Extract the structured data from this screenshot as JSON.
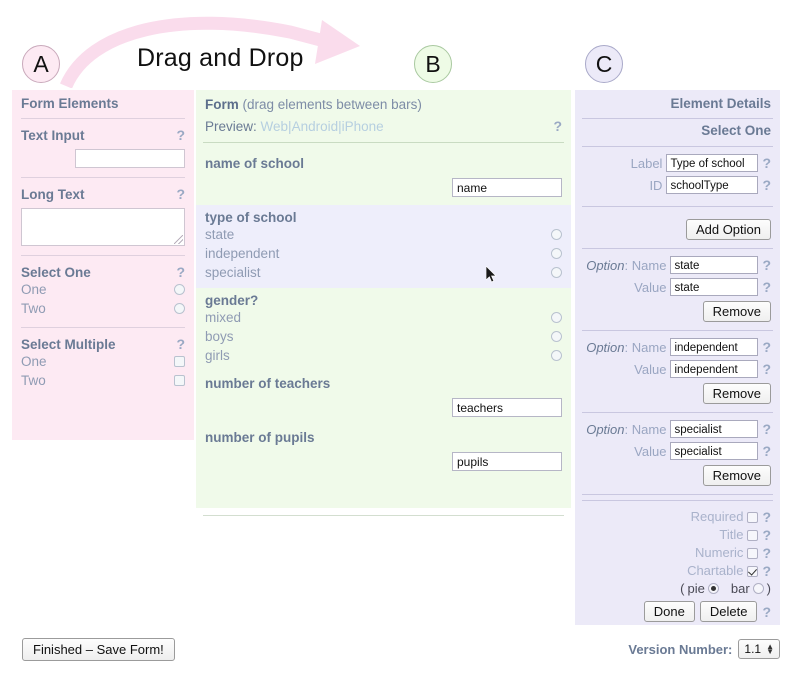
{
  "annotations": {
    "a": "A",
    "b": "B",
    "c": "C",
    "drag_label": "Drag and Drop"
  },
  "panel_a": {
    "title": "Form Elements",
    "help": "?",
    "blocks": [
      {
        "title": "Text Input",
        "help": "?",
        "type": "text"
      },
      {
        "title": "Long Text",
        "help": "?",
        "type": "textarea"
      },
      {
        "title": "Select One",
        "help": "?",
        "type": "radio",
        "options": [
          "One",
          "Two"
        ]
      },
      {
        "title": "Select Multiple",
        "help": "?",
        "type": "checkbox",
        "options": [
          "One",
          "Two"
        ]
      }
    ]
  },
  "panel_b": {
    "title_bold": "Form",
    "title_rest": " (drag elements between bars)",
    "preview_label": "Preview:",
    "preview_links": [
      "Web",
      "Android",
      "iPhone"
    ],
    "preview_separator": "|",
    "help": "?",
    "fields": [
      {
        "label": "name of school",
        "type": "text",
        "value": "name",
        "selected": false
      },
      {
        "label": "type of school",
        "type": "radio",
        "options": [
          "state",
          "independent",
          "specialist"
        ],
        "selected": true
      },
      {
        "label": "gender?",
        "type": "radio",
        "options": [
          "mixed",
          "boys",
          "girls"
        ],
        "selected": false
      },
      {
        "label": "number of teachers",
        "type": "text",
        "value": "teachers",
        "selected": false
      },
      {
        "label": "number of pupils",
        "type": "text",
        "value": "pupils",
        "selected": false
      }
    ]
  },
  "panel_c": {
    "title": "Element Details",
    "subtitle": "Select One",
    "help": "?",
    "label_field": {
      "label": "Label",
      "value": "Type of school",
      "help": "?"
    },
    "id_field": {
      "label": "ID",
      "value": "schoolType",
      "help": "?"
    },
    "add_option_button": "Add Option",
    "option_prefix": "Option",
    "option_name_label": "Name",
    "option_value_label": "Value",
    "remove_button": "Remove",
    "options": [
      {
        "name": "state",
        "value": "state"
      },
      {
        "name": "independent",
        "value": "independent"
      },
      {
        "name": "specialist",
        "value": "specialist"
      }
    ],
    "flags": [
      {
        "label": "Required",
        "checked": false,
        "help": "?"
      },
      {
        "label": "Title",
        "checked": false,
        "help": "?"
      },
      {
        "label": "Numeric",
        "checked": false,
        "help": "?"
      },
      {
        "label": "Chartable",
        "checked": true,
        "help": "?"
      }
    ],
    "chart_type": {
      "open_paren": "(",
      "pie_label": "pie",
      "pie_selected": true,
      "bar_label": "bar",
      "bar_selected": false,
      "close_paren": ")"
    },
    "done_button": "Done",
    "delete_button": "Delete",
    "done_help": "?"
  },
  "bottom": {
    "save_button": "Finished – Save Form!",
    "version_label": "Version Number:",
    "version_value": "1.1"
  },
  "colors": {
    "panel_a_bg": "#fdeaf3",
    "panel_b_bg": "#f0faea",
    "panel_c_bg": "#eceaf8",
    "selected_bg": "#eeeefb",
    "heading_text": "#6a7a94",
    "muted_text": "#8f9bb3",
    "arrow": "#f9dceb"
  }
}
